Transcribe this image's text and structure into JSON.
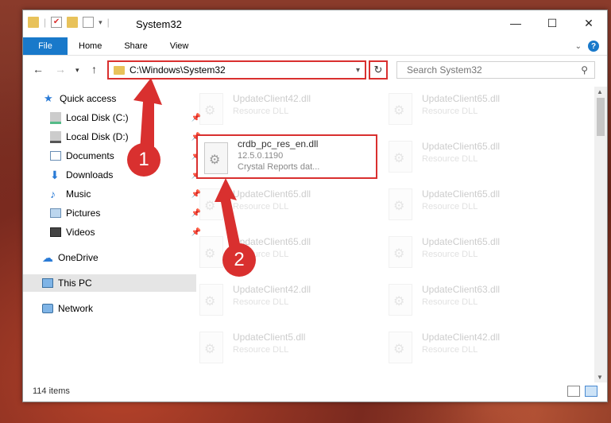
{
  "window": {
    "title": "System32"
  },
  "ribbon": {
    "tabs": [
      "File",
      "Home",
      "Share",
      "View"
    ]
  },
  "address": {
    "path": "C:\\Windows\\System32"
  },
  "search": {
    "placeholder": "Search System32"
  },
  "sidebar": {
    "items": [
      {
        "label": "Quick access",
        "icon": "star-icon"
      },
      {
        "label": "Local Disk (C:)",
        "icon": "drive-icon",
        "pinned": true
      },
      {
        "label": "Local Disk (D:)",
        "icon": "drive-icon",
        "pinned": true
      },
      {
        "label": "Documents",
        "icon": "documents-icon",
        "pinned": true
      },
      {
        "label": "Downloads",
        "icon": "downloads-icon",
        "pinned": true
      },
      {
        "label": "Music",
        "icon": "music-icon",
        "pinned": true
      },
      {
        "label": "Pictures",
        "icon": "pictures-icon",
        "pinned": true
      },
      {
        "label": "Videos",
        "icon": "videos-icon",
        "pinned": true
      },
      {
        "label": "OneDrive",
        "icon": "cloud-icon"
      },
      {
        "label": "This PC",
        "icon": "computer-icon",
        "selected": true
      },
      {
        "label": "Network",
        "icon": "network-icon"
      }
    ]
  },
  "files": [
    {
      "name": "UpdateClient42.dll",
      "desc": "Resource DLL"
    },
    {
      "name": "UpdateClient65.dll",
      "desc": "Resource DLL"
    },
    {
      "name": "crdb_pc_res_en.dll",
      "version": "12.5.0.1190",
      "desc": "Crystal Reports dat..."
    },
    {
      "name": "UpdateClient65.dll",
      "desc": "Resource DLL"
    },
    {
      "name": "UpdateClient65.dll",
      "desc": "Resource DLL"
    },
    {
      "name": "UpdateClient65.dll",
      "desc": "Resource DLL"
    },
    {
      "name": "UpdateClient65.dll",
      "desc": "Resource DLL"
    },
    {
      "name": "UpdateClient65.dll",
      "desc": "Resource DLL"
    },
    {
      "name": "UpdateClient42.dll",
      "desc": "Resource DLL"
    },
    {
      "name": "UpdateClient63.dll",
      "desc": "Resource DLL"
    },
    {
      "name": "UpdateClient5.dll",
      "desc": "Resource DLL"
    },
    {
      "name": "UpdateClient42.dll",
      "desc": "Resource DLL"
    }
  ],
  "status": {
    "count": "114 items"
  },
  "annotations": {
    "badge1": "1",
    "badge2": "2"
  },
  "colors": {
    "accent": "#1979ca",
    "highlight": "#d9302f"
  }
}
